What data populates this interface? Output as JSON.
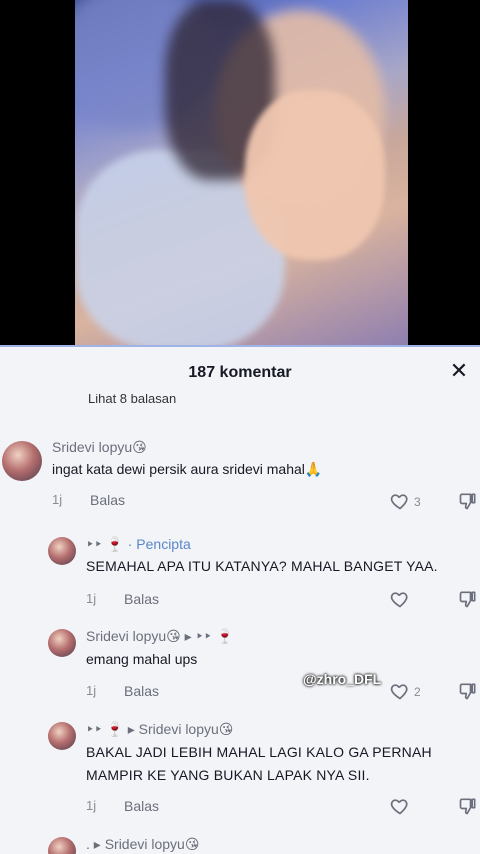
{
  "sheet": {
    "count_label": "187 komentar",
    "close_glyph": "✕",
    "faded_replies_label": "Lihat 8 balasan"
  },
  "comments": [
    {
      "name": "Sridevi lopyu😘",
      "text": "ingat kata dewi persik aura sridevi mahal🙏",
      "time": "1j",
      "reply": "Balas",
      "likes": "3"
    },
    {
      "name_prefix": "‣‣ 🍷",
      "name_suffix": "· Pencipta",
      "text": "SEMAHAL APA ITU KATANYA? MAHAL BANGET YAA.",
      "time": "1j",
      "reply": "Balas",
      "likes": ""
    },
    {
      "name": "Sridevi lopyu😘 ▸ ‣‣ 🍷",
      "text": "emang mahal ups",
      "time": "1j",
      "reply": "Balas",
      "likes": "2"
    },
    {
      "name": "‣‣ 🍷 ▸ Sridevi lopyu😘",
      "text_line1": "BAKAL JADI LEBIH MAHAL LAGI KALO GA PERNAH",
      "text_line2": "MAMPIR KE YANG BUKAN LAPAK NYA SII.",
      "time": "1j",
      "reply": "Balas",
      "likes": ""
    },
    {
      "name": ". ▸ Sridevi lopyu😘"
    }
  ],
  "watermark": "@zhro_DFL",
  "colors": {
    "sheet_bg": "#f3f4f8",
    "creator_accent": "#5a86c9"
  }
}
